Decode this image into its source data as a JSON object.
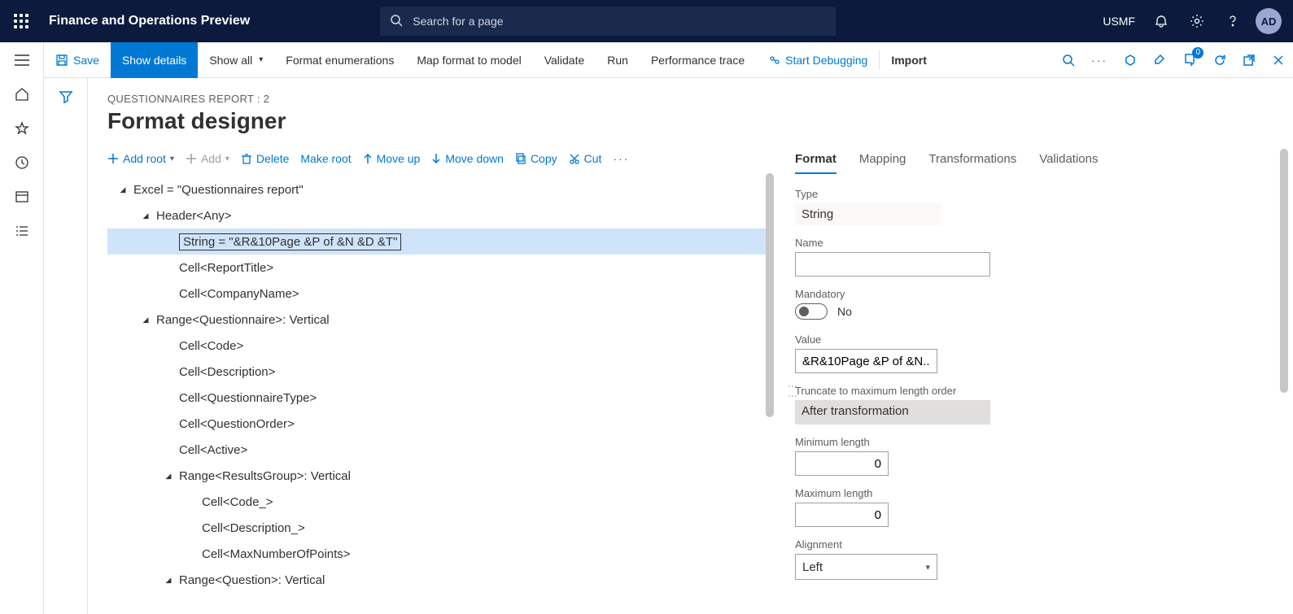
{
  "header": {
    "app_title": "Finance and Operations Preview",
    "search_placeholder": "Search for a page",
    "company": "USMF",
    "avatar": "AD",
    "badge": "0"
  },
  "actionbar": {
    "save": "Save",
    "show_details": "Show details",
    "show_all": "Show all",
    "format_enum": "Format enumerations",
    "map_format": "Map format to model",
    "validate": "Validate",
    "run": "Run",
    "perf_trace": "Performance trace",
    "start_debug": "Start Debugging",
    "import": "Import"
  },
  "page": {
    "crumb": "QUESTIONNAIRES REPORT : 2",
    "title": "Format designer"
  },
  "tree_toolbar": {
    "add_root": "Add root",
    "add": "Add",
    "delete": "Delete",
    "make_root": "Make root",
    "move_up": "Move up",
    "move_down": "Move down",
    "copy": "Copy",
    "cut": "Cut"
  },
  "tree": [
    {
      "indent": 0,
      "exp": true,
      "label": "Excel = \"Questionnaires report\""
    },
    {
      "indent": 1,
      "exp": true,
      "label": "Header<Any>"
    },
    {
      "indent": 2,
      "sel": true,
      "label": "String = \"&R&10Page &P of &N &D &T\""
    },
    {
      "indent": 2,
      "label": "Cell<ReportTitle>"
    },
    {
      "indent": 2,
      "label": "Cell<CompanyName>"
    },
    {
      "indent": 1,
      "exp": true,
      "label": "Range<Questionnaire>: Vertical"
    },
    {
      "indent": 2,
      "label": "Cell<Code>"
    },
    {
      "indent": 2,
      "label": "Cell<Description>"
    },
    {
      "indent": 2,
      "label": "Cell<QuestionnaireType>"
    },
    {
      "indent": 2,
      "label": "Cell<QuestionOrder>"
    },
    {
      "indent": 2,
      "label": "Cell<Active>"
    },
    {
      "indent": 2,
      "exp": true,
      "label": "Range<ResultsGroup>: Vertical"
    },
    {
      "indent": 3,
      "label": "Cell<Code_>"
    },
    {
      "indent": 3,
      "label": "Cell<Description_>"
    },
    {
      "indent": 3,
      "label": "Cell<MaxNumberOfPoints>"
    },
    {
      "indent": 2,
      "exp": true,
      "label": "Range<Question>: Vertical"
    }
  ],
  "tabs": {
    "format": "Format",
    "mapping": "Mapping",
    "transformations": "Transformations",
    "validations": "Validations"
  },
  "form": {
    "type_label": "Type",
    "type_value": "String",
    "name_label": "Name",
    "name_value": "",
    "mandatory_label": "Mandatory",
    "mandatory_text": "No",
    "value_label": "Value",
    "value_value": "&R&10Page &P of &N...",
    "truncate_label": "Truncate to maximum length order",
    "truncate_value": "After transformation",
    "minlen_label": "Minimum length",
    "minlen_value": "0",
    "maxlen_label": "Maximum length",
    "maxlen_value": "0",
    "alignment_label": "Alignment",
    "alignment_value": "Left"
  }
}
